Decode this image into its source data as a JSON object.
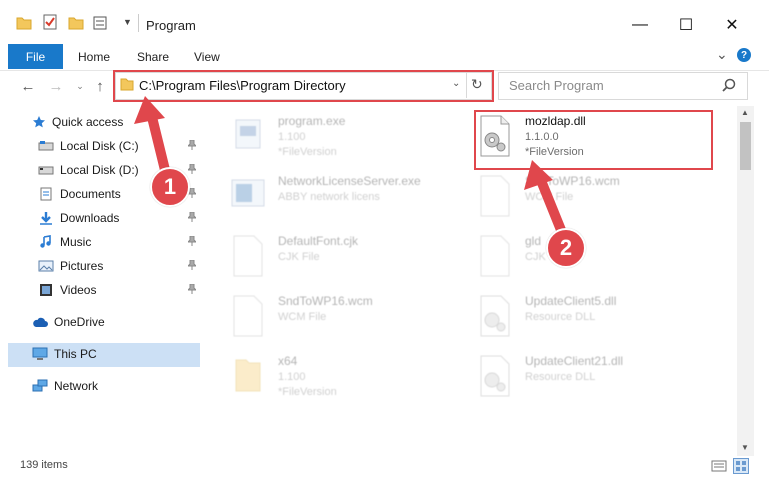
{
  "window": {
    "title": "Program",
    "minimize_glyph": "—",
    "maximize_glyph": "☐",
    "close_glyph": "✕",
    "expand_ribbon_glyph": "⌄",
    "help_glyph": "?"
  },
  "ribbon": {
    "tabs": [
      "File",
      "Home",
      "Share",
      "View"
    ]
  },
  "nav": {
    "address": "C:\\Program Files\\Program Directory",
    "search_placeholder": "Search Program"
  },
  "sidebar": {
    "items": [
      {
        "label": "Quick access",
        "icon": "star-icon"
      },
      {
        "label": "Local Disk (C:)",
        "icon": "drive-icon",
        "pinned": true
      },
      {
        "label": "Local Disk (D:)",
        "icon": "drive-icon",
        "pinned": true
      },
      {
        "label": "Documents",
        "icon": "documents-icon",
        "pinned": true
      },
      {
        "label": "Downloads",
        "icon": "download-icon",
        "pinned": true
      },
      {
        "label": "Music",
        "icon": "music-icon",
        "pinned": true
      },
      {
        "label": "Pictures",
        "icon": "pictures-icon",
        "pinned": true
      },
      {
        "label": "Videos",
        "icon": "videos-icon",
        "pinned": true
      },
      {
        "label": "OneDrive",
        "icon": "cloud-icon"
      },
      {
        "label": "This PC",
        "icon": "computer-icon",
        "selected": true
      },
      {
        "label": "Network",
        "icon": "network-icon"
      }
    ]
  },
  "files": [
    {
      "name": "program.exe",
      "line1": "1.100",
      "line2": "*FileVersion"
    },
    {
      "name": "mozldap.dll",
      "line1": "1.1.0.0",
      "line2": "*FileVersion",
      "highlighted": true
    },
    {
      "name": "NetworkLicenseServer.exe",
      "line1": "ABBY network licens",
      "line2": ""
    },
    {
      "name": "SndToWP16.wcm",
      "line1": "WCM File",
      "line2": ""
    },
    {
      "name": "DefaultFont.cjk",
      "line1": "CJK File",
      "line2": ""
    },
    {
      "name": "gld",
      "line1": "CJK",
      "line2": ""
    },
    {
      "name": "SndToWP16.wcm",
      "line1": "WCM File",
      "line2": ""
    },
    {
      "name": "UpdateClient5.dll",
      "line1": "Resource DLL",
      "line2": ""
    },
    {
      "name": "x64",
      "line1": "1.100",
      "line2": "*FileVersion"
    },
    {
      "name": "UpdateClient21.dll",
      "line1": "Resource DLL",
      "line2": ""
    }
  ],
  "status": {
    "item_count": "139 items"
  },
  "annotations": {
    "step1": "1",
    "step2": "2",
    "color": "#e0474c"
  }
}
